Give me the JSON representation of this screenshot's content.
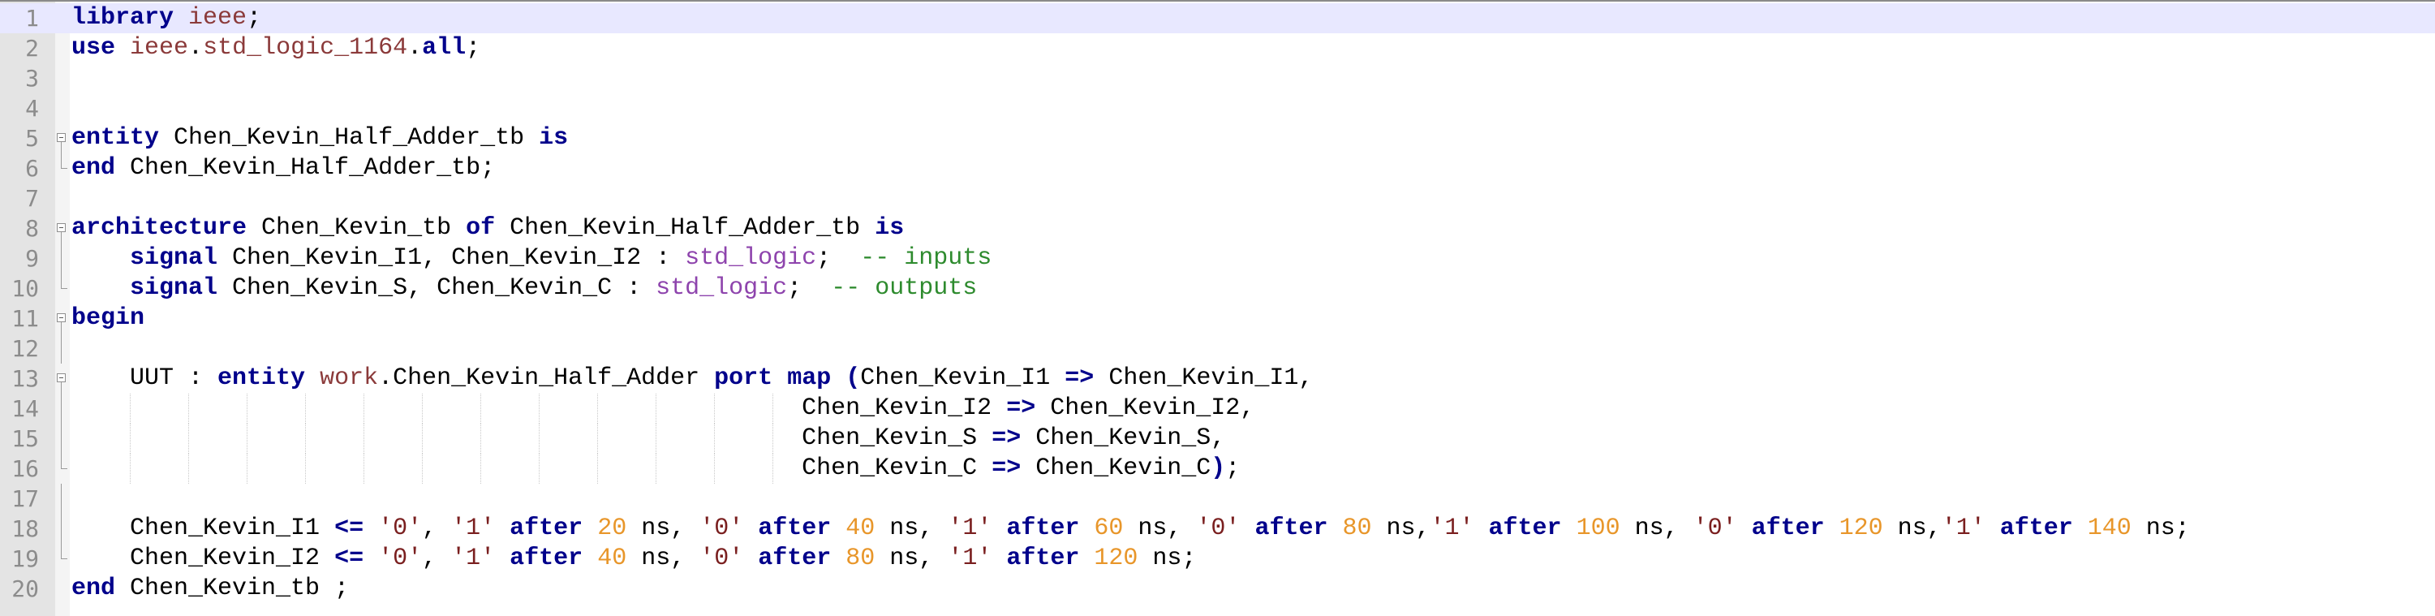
{
  "editor": {
    "language": "VHDL",
    "current_line": 1,
    "lines": [
      {
        "n": "1",
        "fold": "none",
        "tokens": [
          {
            "t": "library",
            "c": "kw"
          },
          {
            "t": " "
          },
          {
            "t": "ieee",
            "c": "lib"
          },
          {
            "t": ";"
          }
        ]
      },
      {
        "n": "2",
        "fold": "none",
        "tokens": [
          {
            "t": "use",
            "c": "kw"
          },
          {
            "t": " "
          },
          {
            "t": "ieee",
            "c": "lib"
          },
          {
            "t": "."
          },
          {
            "t": "std_logic_1164",
            "c": "lib"
          },
          {
            "t": "."
          },
          {
            "t": "all",
            "c": "kw"
          },
          {
            "t": ";"
          }
        ]
      },
      {
        "n": "3",
        "fold": "none",
        "tokens": []
      },
      {
        "n": "4",
        "fold": "none",
        "tokens": []
      },
      {
        "n": "5",
        "fold": "open",
        "tokens": [
          {
            "t": "entity",
            "c": "kw"
          },
          {
            "t": " Chen_Kevin_Half_Adder_tb "
          },
          {
            "t": "is",
            "c": "kw"
          }
        ]
      },
      {
        "n": "6",
        "fold": "end",
        "tokens": [
          {
            "t": "end",
            "c": "kw"
          },
          {
            "t": " Chen_Kevin_Half_Adder_tb;"
          }
        ]
      },
      {
        "n": "7",
        "fold": "none",
        "tokens": []
      },
      {
        "n": "8",
        "fold": "open",
        "tokens": [
          {
            "t": "architecture",
            "c": "kw"
          },
          {
            "t": " Chen_Kevin_tb "
          },
          {
            "t": "of",
            "c": "kw"
          },
          {
            "t": " Chen_Kevin_Half_Adder_tb "
          },
          {
            "t": "is",
            "c": "kw"
          }
        ]
      },
      {
        "n": "9",
        "fold": "mid",
        "tokens": [
          {
            "t": "    "
          },
          {
            "t": "signal",
            "c": "kw"
          },
          {
            "t": " Chen_Kevin_I1, Chen_Kevin_I2 : "
          },
          {
            "t": "std_logic",
            "c": "ty"
          },
          {
            "t": ";  "
          },
          {
            "t": "-- inputs",
            "c": "cm"
          }
        ]
      },
      {
        "n": "10",
        "fold": "end",
        "tokens": [
          {
            "t": "    "
          },
          {
            "t": "signal",
            "c": "kw"
          },
          {
            "t": " Chen_Kevin_S, Chen_Kevin_C : "
          },
          {
            "t": "std_logic",
            "c": "ty"
          },
          {
            "t": ";  "
          },
          {
            "t": "-- outputs",
            "c": "cm"
          }
        ]
      },
      {
        "n": "11",
        "fold": "open",
        "tokens": [
          {
            "t": "begin",
            "c": "kw"
          }
        ]
      },
      {
        "n": "12",
        "fold": "mid",
        "tokens": []
      },
      {
        "n": "13",
        "fold": "open2",
        "tokens": [
          {
            "t": "    UUT : "
          },
          {
            "t": "entity",
            "c": "kw"
          },
          {
            "t": " "
          },
          {
            "t": "work",
            "c": "lib"
          },
          {
            "t": ".Chen_Kevin_Half_Adder "
          },
          {
            "t": "port",
            "c": "kw"
          },
          {
            "t": " "
          },
          {
            "t": "map",
            "c": "kw"
          },
          {
            "t": " "
          },
          {
            "t": "(",
            "c": "op"
          },
          {
            "t": "Chen_Kevin_I1 "
          },
          {
            "t": "=>",
            "c": "op"
          },
          {
            "t": " Chen_Kevin_I1,"
          }
        ]
      },
      {
        "n": "14",
        "fold": "mid",
        "tokens": [
          {
            "t": "                                                  Chen_Kevin_I2 "
          },
          {
            "t": "=>",
            "c": "op"
          },
          {
            "t": " Chen_Kevin_I2,"
          }
        ]
      },
      {
        "n": "15",
        "fold": "mid",
        "tokens": [
          {
            "t": "                                                  Chen_Kevin_S "
          },
          {
            "t": "=>",
            "c": "op"
          },
          {
            "t": " Chen_Kevin_S,"
          }
        ]
      },
      {
        "n": "16",
        "fold": "end",
        "tokens": [
          {
            "t": "                                                  Chen_Kevin_C "
          },
          {
            "t": "=>",
            "c": "op"
          },
          {
            "t": " Chen_Kevin_C"
          },
          {
            "t": ")",
            "c": "op"
          },
          {
            "t": ";"
          }
        ]
      },
      {
        "n": "17",
        "fold": "mid",
        "tokens": []
      },
      {
        "n": "18",
        "fold": "mid",
        "tokens": [
          {
            "t": "    Chen_Kevin_I1 "
          },
          {
            "t": "<=",
            "c": "op"
          },
          {
            "t": " "
          },
          {
            "t": "'0'",
            "c": "str"
          },
          {
            "t": ", "
          },
          {
            "t": "'1'",
            "c": "str"
          },
          {
            "t": " "
          },
          {
            "t": "after",
            "c": "kw"
          },
          {
            "t": " "
          },
          {
            "t": "20",
            "c": "num"
          },
          {
            "t": " ns, "
          },
          {
            "t": "'0'",
            "c": "str"
          },
          {
            "t": " "
          },
          {
            "t": "after",
            "c": "kw"
          },
          {
            "t": " "
          },
          {
            "t": "40",
            "c": "num"
          },
          {
            "t": " ns, "
          },
          {
            "t": "'1'",
            "c": "str"
          },
          {
            "t": " "
          },
          {
            "t": "after",
            "c": "kw"
          },
          {
            "t": " "
          },
          {
            "t": "60",
            "c": "num"
          },
          {
            "t": " ns, "
          },
          {
            "t": "'0'",
            "c": "str"
          },
          {
            "t": " "
          },
          {
            "t": "after",
            "c": "kw"
          },
          {
            "t": " "
          },
          {
            "t": "80",
            "c": "num"
          },
          {
            "t": " ns,"
          },
          {
            "t": "'1'",
            "c": "str"
          },
          {
            "t": " "
          },
          {
            "t": "after",
            "c": "kw"
          },
          {
            "t": " "
          },
          {
            "t": "100",
            "c": "num"
          },
          {
            "t": " ns, "
          },
          {
            "t": "'0'",
            "c": "str"
          },
          {
            "t": " "
          },
          {
            "t": "after",
            "c": "kw"
          },
          {
            "t": " "
          },
          {
            "t": "120",
            "c": "num"
          },
          {
            "t": " ns,"
          },
          {
            "t": "'1'",
            "c": "str"
          },
          {
            "t": " "
          },
          {
            "t": "after",
            "c": "kw"
          },
          {
            "t": " "
          },
          {
            "t": "140",
            "c": "num"
          },
          {
            "t": " ns;"
          }
        ]
      },
      {
        "n": "19",
        "fold": "end",
        "tokens": [
          {
            "t": "    Chen_Kevin_I2 "
          },
          {
            "t": "<=",
            "c": "op"
          },
          {
            "t": " "
          },
          {
            "t": "'0'",
            "c": "str"
          },
          {
            "t": ", "
          },
          {
            "t": "'1'",
            "c": "str"
          },
          {
            "t": " "
          },
          {
            "t": "after",
            "c": "kw"
          },
          {
            "t": " "
          },
          {
            "t": "40",
            "c": "num"
          },
          {
            "t": " ns, "
          },
          {
            "t": "'0'",
            "c": "str"
          },
          {
            "t": " "
          },
          {
            "t": "after",
            "c": "kw"
          },
          {
            "t": " "
          },
          {
            "t": "80",
            "c": "num"
          },
          {
            "t": " ns, "
          },
          {
            "t": "'1'",
            "c": "str"
          },
          {
            "t": " "
          },
          {
            "t": "after",
            "c": "kw"
          },
          {
            "t": " "
          },
          {
            "t": "120",
            "c": "num"
          },
          {
            "t": " ns;"
          }
        ]
      },
      {
        "n": "20",
        "fold": "none",
        "tokens": [
          {
            "t": "end",
            "c": "kw"
          },
          {
            "t": " Chen_Kevin_tb ;"
          }
        ]
      }
    ]
  }
}
